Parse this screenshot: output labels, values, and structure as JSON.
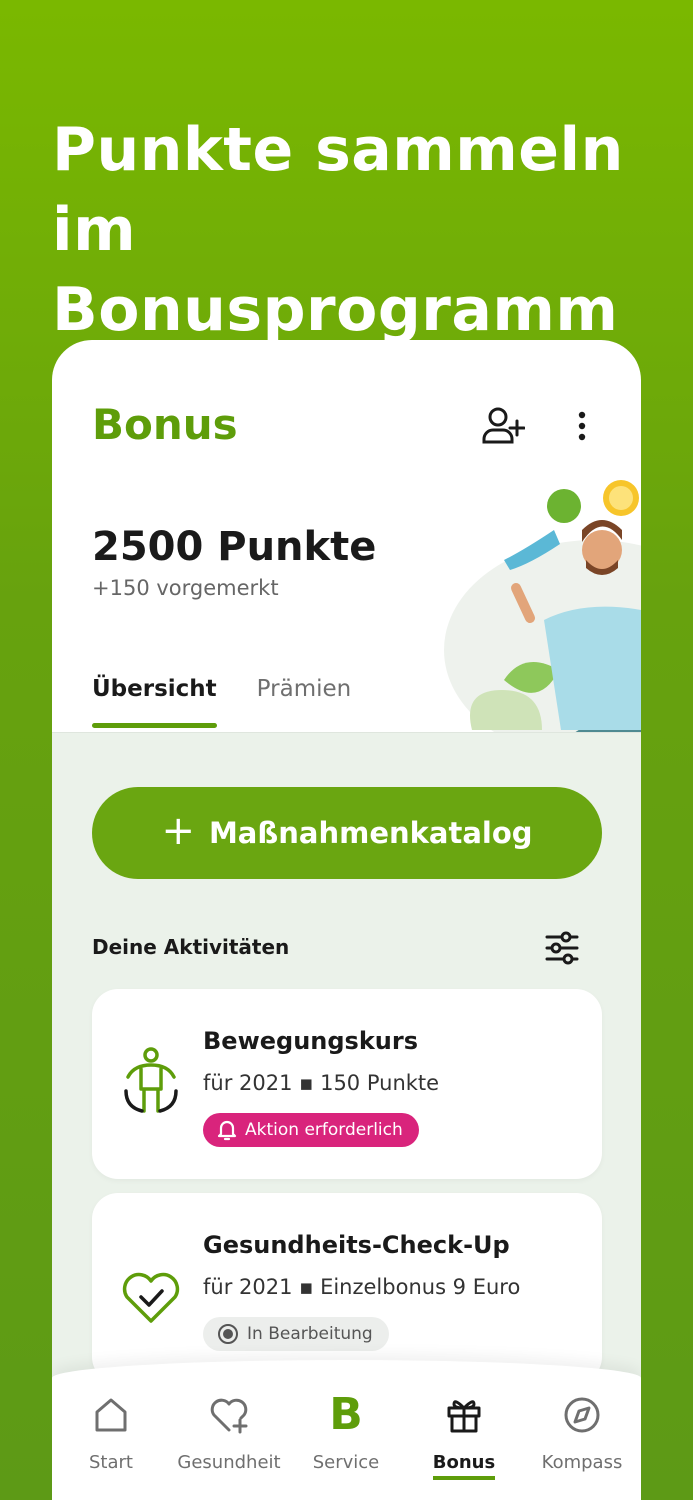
{
  "headline": "Punkte sammeln im Bonusprogramm",
  "header": {
    "title": "Bonus",
    "add_user_icon": "person-add-icon",
    "more_icon": "more-vertical-icon"
  },
  "summary": {
    "points": "2500 Punkte",
    "pending": "+150 vorgemerkt"
  },
  "tabs": [
    {
      "label": "Übersicht",
      "active": true
    },
    {
      "label": "Prämien",
      "active": false
    }
  ],
  "catalog_button": {
    "label": "Maßnahmenkatalog",
    "icon": "plus-icon"
  },
  "activities": {
    "title": "Deine Aktivitäten",
    "filter_icon": "filter-sliders-icon",
    "items": [
      {
        "title": "Bewegungskurs",
        "subtitle_year": "für 2021",
        "subtitle_detail": "150 Punkte",
        "badge": "Aktion erforderlich",
        "badge_icon": "bell-icon",
        "icon": "exercise-person-icon"
      },
      {
        "title": "Gesundheits-Check-Up",
        "subtitle_year": "für 2021",
        "subtitle_detail": "Einzelbonus 9 Euro",
        "badge": "In Bearbeitung",
        "badge_icon": "in-progress-icon",
        "icon": "heart-check-icon"
      }
    ]
  },
  "bottom_nav": [
    {
      "label": "Start",
      "icon": "home-icon"
    },
    {
      "label": "Gesundheit",
      "icon": "heart-plus-icon"
    },
    {
      "label": "Service",
      "icon": "service-b-icon",
      "glyph": "B"
    },
    {
      "label": "Bonus",
      "icon": "gift-icon",
      "active": true
    },
    {
      "label": "Kompass",
      "icon": "compass-icon"
    }
  ],
  "colors": {
    "brand_green": "#5e9d0a",
    "button_green": "#6aa611",
    "badge_pink": "#d9247c",
    "content_bg": "#ebf2ea"
  }
}
